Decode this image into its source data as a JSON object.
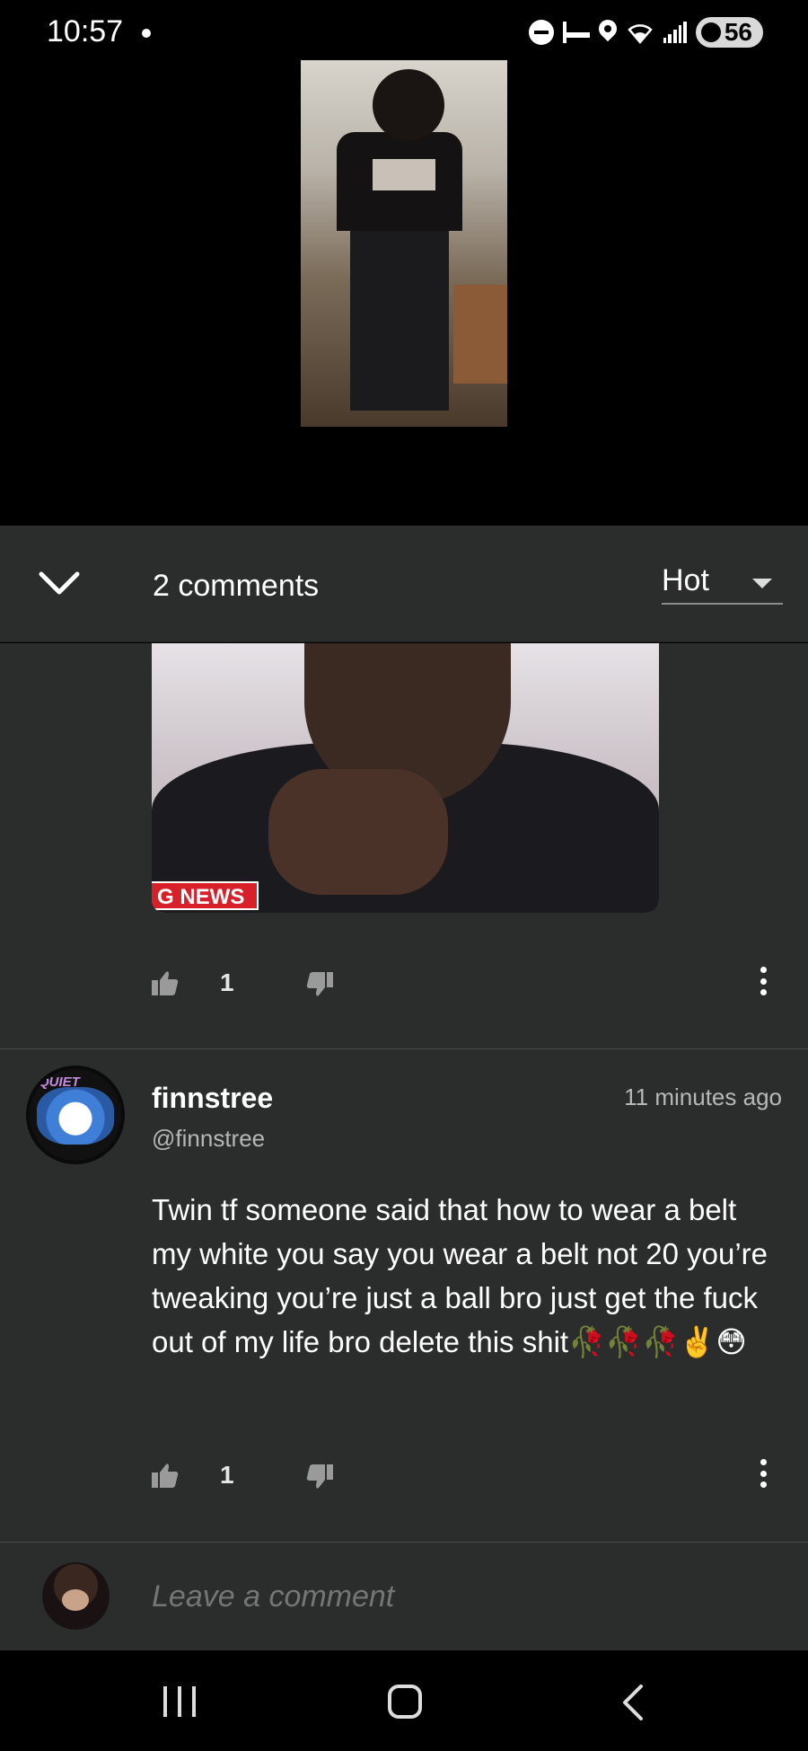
{
  "status_bar": {
    "time": "10:57",
    "battery": "56",
    "icons": [
      "dnd-icon",
      "sleep-icon",
      "location-icon",
      "wifi-icon",
      "signal-icon",
      "battery-saver-icon"
    ]
  },
  "comments_header": {
    "count_label": "2 comments",
    "sort_value": "Hot"
  },
  "first_comment": {
    "media_tag": "G NEWS",
    "likes": "1"
  },
  "second_comment": {
    "name": "finnstree",
    "handle": "@finnstree",
    "time": "11 minutes ago",
    "body": "Twin tf someone said that how to wear a belt my white you say you wear a belt not 20 you’re tweaking you’re just a ball bro just get the fuck out of my life bro delete this shit🥀🥀🥀✌️😳",
    "likes": "1",
    "avatar_badge": "QUIET"
  },
  "compose": {
    "placeholder": "Leave a comment"
  },
  "colors": {
    "panel": "#2b2d2c",
    "divider": "#494b4a",
    "muted_text": "#b7b7b7"
  }
}
